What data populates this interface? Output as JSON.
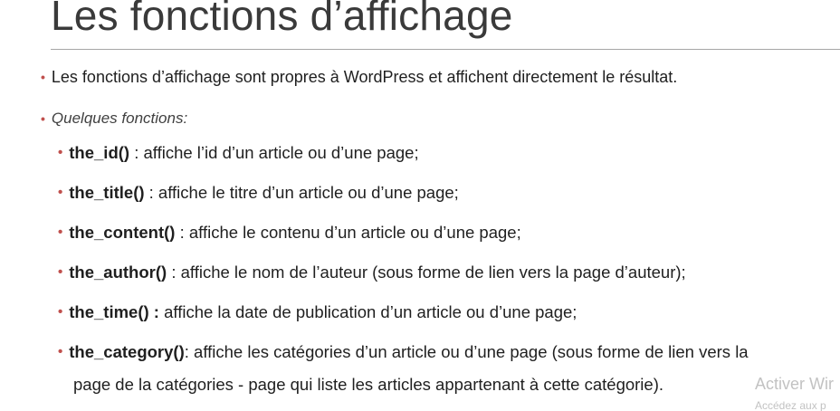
{
  "slide": {
    "title": "Les fonctions d’affichage",
    "intro": "Les fonctions d’affichage sont propres à WordPress et affichent directement le résultat.",
    "subheading": "Quelques fonctions:",
    "functions": [
      {
        "name": "the_id()",
        "desc": " : affiche l’id d’un article ou d’une page;"
      },
      {
        "name": "the_title()",
        "desc": " : affiche le titre d’un article ou d’une page;"
      },
      {
        "name": "the_content()",
        "desc": " : affiche le contenu d’un article ou d’une page;"
      },
      {
        "name": "the_author()",
        "desc": " : affiche le nom de l’auteur (sous forme de lien vers la page d’auteur);"
      },
      {
        "name": "the_time() :",
        "desc": " affiche la date de publication d’un article ou d’une page;"
      },
      {
        "name": "the_category()",
        "desc": ": affiche les catégories d’un article ou d’une page (sous forme de lien vers la"
      }
    ],
    "category_continuation": "page de la catégories - page qui liste les articles appartenant à cette catégorie).",
    "bullet_color": "#c0504d"
  },
  "watermark": {
    "line1": "Activer Wir",
    "line2": "Accédez aux p"
  }
}
